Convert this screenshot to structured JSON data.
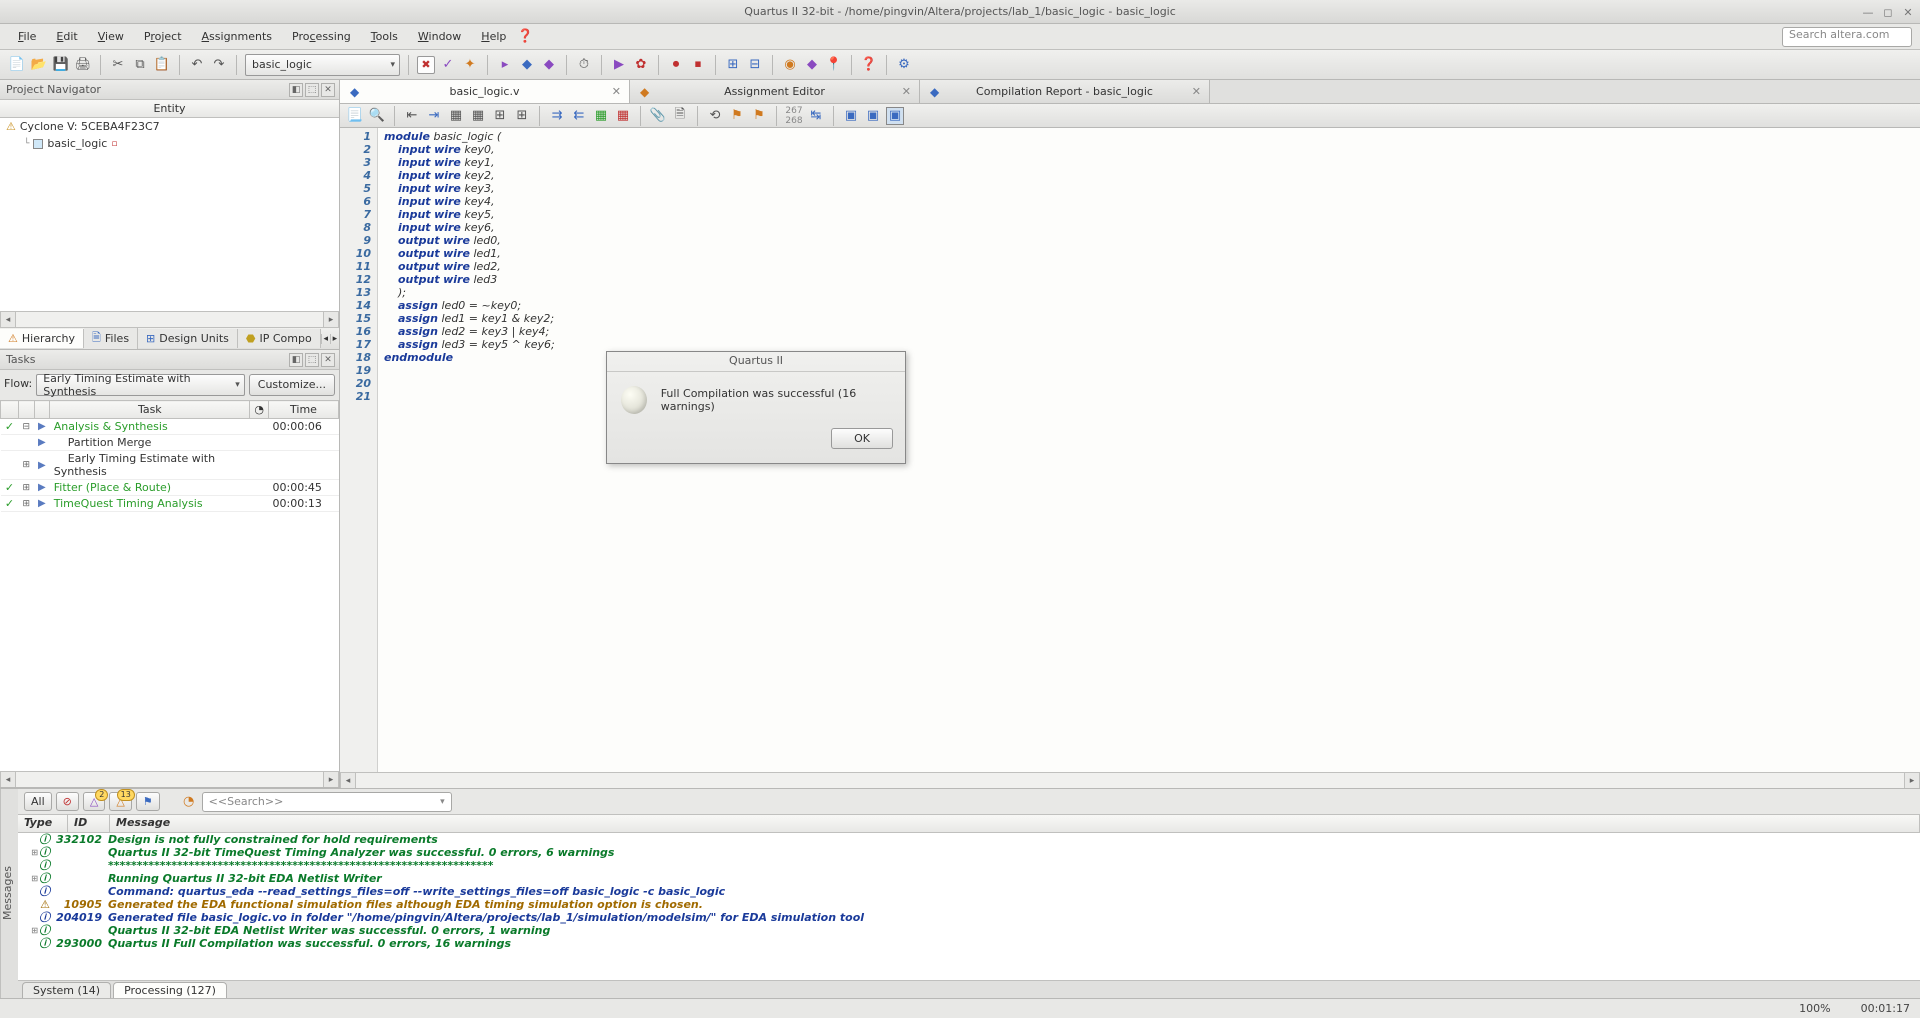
{
  "window": {
    "title": "Quartus II 32-bit - /home/pingvin/Altera/projects/lab_1/basic_logic - basic_logic"
  },
  "menubar": {
    "items": [
      "File",
      "Edit",
      "View",
      "Project",
      "Assignments",
      "Processing",
      "Tools",
      "Window",
      "Help"
    ],
    "search_placeholder": "Search altera.com"
  },
  "toolbar": {
    "project_combo": "basic_logic"
  },
  "project_navigator": {
    "title": "Project Navigator",
    "entity_header": "Entity",
    "root": "Cyclone V: 5CEBA4F23C7",
    "child": "basic_logic",
    "tabs": [
      "Hierarchy",
      "Files",
      "Design Units",
      "IP Compo"
    ]
  },
  "tasks": {
    "title": "Tasks",
    "flow_label": "Flow:",
    "flow_value": "Early Timing Estimate with Synthesis",
    "customize": "Customize...",
    "col_task": "Task",
    "col_time": "Time",
    "rows": [
      {
        "chk": "✓",
        "exp": "⊟",
        "name": "Analysis & Synthesis",
        "cls": "green",
        "time": "00:00:06",
        "run": "▶"
      },
      {
        "chk": "",
        "exp": "",
        "name": "Partition Merge",
        "cls": "",
        "time": "",
        "run": "▶",
        "indent": 1
      },
      {
        "chk": "",
        "exp": "⊞",
        "name": "Early Timing Estimate with Synthesis",
        "cls": "",
        "time": "",
        "run": "▶",
        "indent": 1
      },
      {
        "chk": "✓",
        "exp": "⊞",
        "name": "Fitter (Place & Route)",
        "cls": "green",
        "time": "00:00:45",
        "run": "▶"
      },
      {
        "chk": "✓",
        "exp": "⊞",
        "name": "TimeQuest Timing Analysis",
        "cls": "green",
        "time": "00:00:13",
        "run": "▶"
      }
    ]
  },
  "editor_tabs": [
    {
      "label": "basic_logic.v",
      "active": true,
      "ico": "📄"
    },
    {
      "label": "Assignment Editor",
      "active": false,
      "ico": "◆"
    },
    {
      "label": "Compilation Report - basic_logic",
      "active": false,
      "ico": "◆"
    }
  ],
  "code": {
    "lines": [
      {
        "n": 1,
        "seg": [
          {
            "c": "kw",
            "t": "module"
          },
          {
            "c": "id",
            "t": " basic_logic ("
          }
        ]
      },
      {
        "n": 2,
        "seg": [
          {
            "c": "id",
            "t": "    "
          },
          {
            "c": "kw",
            "t": "input"
          },
          {
            "c": "id",
            "t": " "
          },
          {
            "c": "ty",
            "t": "wire"
          },
          {
            "c": "id",
            "t": " key0,"
          }
        ]
      },
      {
        "n": 3,
        "seg": [
          {
            "c": "id",
            "t": "    "
          },
          {
            "c": "kw",
            "t": "input"
          },
          {
            "c": "id",
            "t": " "
          },
          {
            "c": "ty",
            "t": "wire"
          },
          {
            "c": "id",
            "t": " key1,"
          }
        ]
      },
      {
        "n": 4,
        "seg": [
          {
            "c": "id",
            "t": "    "
          },
          {
            "c": "kw",
            "t": "input"
          },
          {
            "c": "id",
            "t": " "
          },
          {
            "c": "ty",
            "t": "wire"
          },
          {
            "c": "id",
            "t": " key2,"
          }
        ]
      },
      {
        "n": 5,
        "seg": [
          {
            "c": "id",
            "t": "    "
          },
          {
            "c": "kw",
            "t": "input"
          },
          {
            "c": "id",
            "t": " "
          },
          {
            "c": "ty",
            "t": "wire"
          },
          {
            "c": "id",
            "t": " key3,"
          }
        ]
      },
      {
        "n": 6,
        "seg": [
          {
            "c": "id",
            "t": "    "
          },
          {
            "c": "kw",
            "t": "input"
          },
          {
            "c": "id",
            "t": " "
          },
          {
            "c": "ty",
            "t": "wire"
          },
          {
            "c": "id",
            "t": " key4,"
          }
        ]
      },
      {
        "n": 7,
        "seg": [
          {
            "c": "id",
            "t": "    "
          },
          {
            "c": "kw",
            "t": "input"
          },
          {
            "c": "id",
            "t": " "
          },
          {
            "c": "ty",
            "t": "wire"
          },
          {
            "c": "id",
            "t": " key5,"
          }
        ]
      },
      {
        "n": 8,
        "seg": [
          {
            "c": "id",
            "t": "    "
          },
          {
            "c": "kw",
            "t": "input"
          },
          {
            "c": "id",
            "t": " "
          },
          {
            "c": "ty",
            "t": "wire"
          },
          {
            "c": "id",
            "t": " key6,"
          }
        ]
      },
      {
        "n": 9,
        "seg": [
          {
            "c": "id",
            "t": "    "
          },
          {
            "c": "kw",
            "t": "output"
          },
          {
            "c": "id",
            "t": " "
          },
          {
            "c": "ty",
            "t": "wire"
          },
          {
            "c": "id",
            "t": " led0,"
          }
        ]
      },
      {
        "n": 10,
        "seg": [
          {
            "c": "id",
            "t": "    "
          },
          {
            "c": "kw",
            "t": "output"
          },
          {
            "c": "id",
            "t": " "
          },
          {
            "c": "ty",
            "t": "wire"
          },
          {
            "c": "id",
            "t": " led1,"
          }
        ]
      },
      {
        "n": 11,
        "seg": [
          {
            "c": "id",
            "t": "    "
          },
          {
            "c": "kw",
            "t": "output"
          },
          {
            "c": "id",
            "t": " "
          },
          {
            "c": "ty",
            "t": "wire"
          },
          {
            "c": "id",
            "t": " led2,"
          }
        ]
      },
      {
        "n": 12,
        "seg": [
          {
            "c": "id",
            "t": "    "
          },
          {
            "c": "kw",
            "t": "output"
          },
          {
            "c": "id",
            "t": " "
          },
          {
            "c": "ty",
            "t": "wire"
          },
          {
            "c": "id",
            "t": " led3"
          }
        ]
      },
      {
        "n": 13,
        "seg": [
          {
            "c": "id",
            "t": "    );"
          }
        ]
      },
      {
        "n": 14,
        "seg": [
          {
            "c": "id",
            "t": ""
          }
        ]
      },
      {
        "n": 15,
        "seg": [
          {
            "c": "id",
            "t": "    "
          },
          {
            "c": "kw",
            "t": "assign"
          },
          {
            "c": "id",
            "t": " led0 = ~key0;"
          }
        ]
      },
      {
        "n": 16,
        "seg": [
          {
            "c": "id",
            "t": "    "
          },
          {
            "c": "kw",
            "t": "assign"
          },
          {
            "c": "id",
            "t": " led1 = key1 & key2;"
          }
        ]
      },
      {
        "n": 17,
        "seg": [
          {
            "c": "id",
            "t": "    "
          },
          {
            "c": "kw",
            "t": "assign"
          },
          {
            "c": "id",
            "t": " led2 = key3 | key4;"
          }
        ]
      },
      {
        "n": 18,
        "seg": [
          {
            "c": "id",
            "t": "    "
          },
          {
            "c": "kw",
            "t": "assign"
          },
          {
            "c": "id",
            "t": " led3 = key5 ^ key6;"
          }
        ]
      },
      {
        "n": 19,
        "seg": [
          {
            "c": "id",
            "t": ""
          }
        ]
      },
      {
        "n": 20,
        "seg": [
          {
            "c": "kw",
            "t": "endmodule"
          }
        ]
      },
      {
        "n": 21,
        "seg": [
          {
            "c": "id",
            "t": ""
          }
        ]
      }
    ]
  },
  "messages": {
    "side_label": "Messages",
    "filters": {
      "all": "All"
    },
    "search_placeholder": "<<Search>>",
    "cols": {
      "type": "Type",
      "id": "ID",
      "msg": "Message"
    },
    "rows": [
      {
        "cls": "g",
        "ic": "ⓘ",
        "id": "332102",
        "txt": "Design is not fully constrained for hold requirements"
      },
      {
        "cls": "g",
        "ic": "ⓘ",
        "id": "",
        "txt": "Quartus II 32-bit TimeQuest Timing Analyzer was successful. 0 errors, 6 warnings"
      },
      {
        "cls": "g",
        "ic": "ⓘ",
        "id": "",
        "txt": "*******************************************************************"
      },
      {
        "cls": "g",
        "ic": "ⓘ",
        "id": "",
        "txt": "Running Quartus II 32-bit EDA Netlist Writer"
      },
      {
        "cls": "b",
        "ic": "ⓘ",
        "id": "",
        "txt": "Command: quartus_eda --read_settings_files=off --write_settings_files=off basic_logic -c basic_logic"
      },
      {
        "cls": "w",
        "ic": "⚠",
        "id": "10905",
        "txt": "Generated the EDA functional simulation files although EDA timing simulation option is chosen."
      },
      {
        "cls": "b",
        "ic": "ⓘ",
        "id": "204019",
        "txt": "Generated file basic_logic.vo in folder \"/home/pingvin/Altera/projects/lab_1/simulation/modelsim/\" for EDA simulation tool"
      },
      {
        "cls": "g",
        "ic": "ⓘ",
        "id": "",
        "txt": "Quartus II 32-bit EDA Netlist Writer was successful. 0 errors, 1 warning"
      },
      {
        "cls": "g",
        "ic": "ⓘ",
        "id": "293000",
        "txt": "Quartus II Full Compilation was successful. 0 errors, 16 warnings"
      }
    ],
    "bottom_tabs": [
      {
        "label": "System (14)",
        "active": false
      },
      {
        "label": "Processing (127)",
        "active": true
      }
    ],
    "warn_badges": {
      "tri2": "2",
      "tri13": "13"
    }
  },
  "dialog": {
    "title": "Quartus II",
    "message": "Full Compilation was successful (16 warnings)",
    "ok": "OK"
  },
  "status": {
    "zoom": "100%",
    "time": "00:01:17"
  }
}
